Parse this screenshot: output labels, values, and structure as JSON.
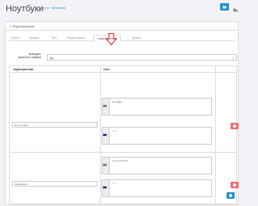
{
  "header": {
    "title": "Ноутбуки",
    "breadcrumb": [
      "Главная",
      "Категории"
    ]
  },
  "panel": {
    "heading": "Редактирование"
  },
  "tabs": [
    "Общие",
    "Данные",
    "SEO",
    "Рекомендации",
    "Характеристики",
    "Дизайн"
  ],
  "active_tab": "Характеристики",
  "form": {
    "multiplicity_label_line1": "Выводить",
    "multiplicity_label_line2": "кратность товаров",
    "multiplicity_value": "Да"
  },
  "table": {
    "col_characteristic": "Характеристика",
    "col_text": "Текст",
    "rows": [
      {
        "name": "No. of Cores",
        "ru_text": "2-6 ядер",
        "en_text": "Текст"
      },
      {
        "name": "Clockspeed",
        "ru_text": "от 2 до 4.5 Ггц",
        "en_text": "Текст"
      }
    ]
  },
  "colors": {
    "primary": "#1e91cf",
    "danger": "#f56b6b",
    "annotation_arrow": "#e02020"
  }
}
